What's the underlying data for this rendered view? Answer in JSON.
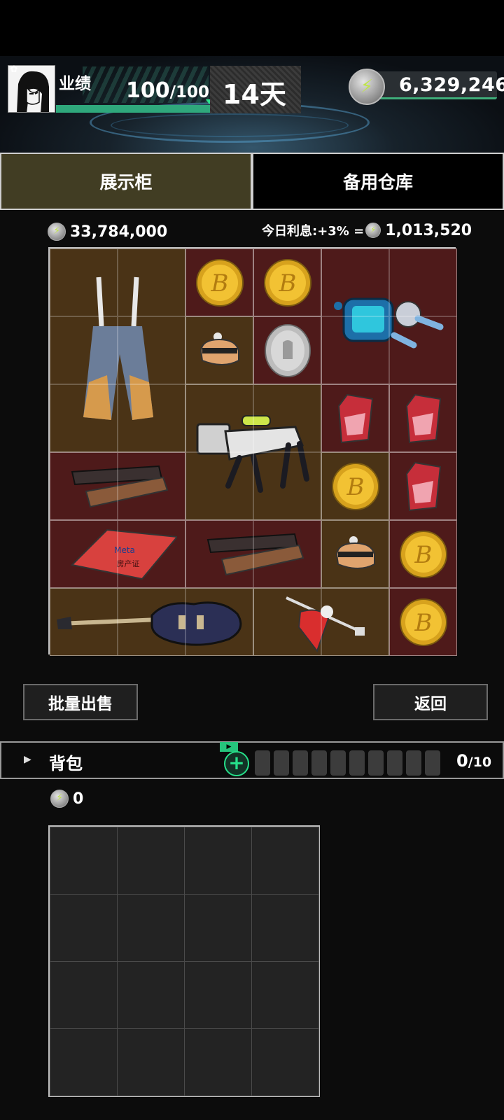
{
  "header": {
    "performance_label": "业绩",
    "performance_current": "100",
    "performance_max": "/100",
    "performance_fraction": 1.0,
    "days": "14天",
    "coins_total": "6,329,246"
  },
  "tabs": [
    {
      "label": "展示柜",
      "active": true
    },
    {
      "label": "备用仓库",
      "active": false
    }
  ],
  "showcase": {
    "value_total": "33,784,000",
    "interest_label": "今日利息:+3% =",
    "interest_amount": "1,013,520",
    "items": [
      {
        "name": "overalls",
        "bg": "brown"
      },
      {
        "name": "bitcoin",
        "bg": "red"
      },
      {
        "name": "bitcoin",
        "bg": "red"
      },
      {
        "name": "robot-drone",
        "bg": "red"
      },
      {
        "name": "helmet-figurine",
        "bg": "brown"
      },
      {
        "name": "silver-coin",
        "bg": "red"
      },
      {
        "name": "robot-dog",
        "bg": "brown"
      },
      {
        "name": "red-crystal",
        "bg": "red"
      },
      {
        "name": "red-crystal",
        "bg": "red"
      },
      {
        "name": "wooden-box",
        "bg": "red"
      },
      {
        "name": "bitcoin",
        "bg": "brown"
      },
      {
        "name": "red-crystal",
        "bg": "red"
      },
      {
        "name": "meta-certificate",
        "bg": "red",
        "text": "Meta",
        "subtext": "房产证"
      },
      {
        "name": "wooden-box",
        "bg": "red"
      },
      {
        "name": "helmet-figurine",
        "bg": "brown"
      },
      {
        "name": "bitcoin",
        "bg": "red"
      },
      {
        "name": "electric-guitar",
        "bg": "brown"
      },
      {
        "name": "spinning-top",
        "bg": "brown"
      },
      {
        "name": "bitcoin",
        "bg": "red"
      }
    ]
  },
  "buttons": {
    "batch_sell": "批量出售",
    "back": "返回"
  },
  "backpack": {
    "label": "背包",
    "video_icon": "video-ad-icon",
    "count": "0",
    "capacity": "/10",
    "value": "0"
  },
  "colors": {
    "accent_green": "#2fa87c",
    "tab_active": "#413d23",
    "cell_brown": "#4a3316",
    "cell_red": "#4e1a1a"
  }
}
